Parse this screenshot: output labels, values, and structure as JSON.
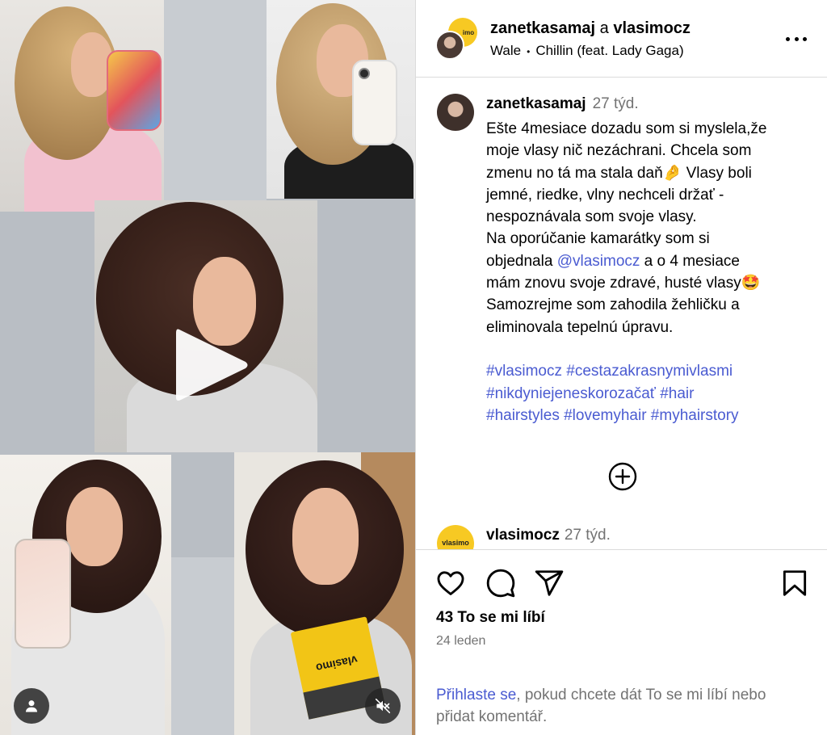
{
  "header": {
    "user1": "zanetkasamaj",
    "joiner": "a",
    "user2": "vlasimocz",
    "audio_artist": "Wale",
    "audio_track": "Chillin (feat. Lady Gaga)",
    "avatar_brand_text": "imo",
    "more_icon": "more-horizontal-icon"
  },
  "caption": {
    "username": "zanetkasamaj",
    "time_ago": "27 týd.",
    "lines": [
      "Ešte 4mesiace dozadu som si myslela,že",
      "moje vlasy nič nezáchrani. Chcela som",
      "zmenu no tá ma stala daň🤌 Vlasy boli",
      "jemné, riedke, vlny nechceli držať -",
      "nespoznávala som svoje vlasy.",
      "Na oporúčanie kamarátky som si"
    ],
    "mention_prefix": "objednala ",
    "mention": "@vlasimocz",
    "mention_suffix": " a o 4 mesiace",
    "lines_after": [
      "mám znovu svoje zdravé, husté vlasy🤩",
      "Samozrejme som zahodila žehličku a",
      "eliminovala tepelnú úpravu."
    ],
    "hashtags_line1": "#vlasimocz #cestazakrasnymivlasmi",
    "hashtags_line2": "#nikdyniejeneskorozačať #hair",
    "hashtags_line3": "#hairstyles #lovemyhair #myhairstory"
  },
  "comment": {
    "username": "vlasimocz",
    "time_ago": "27 týd.",
    "avatar_text": "vlasimo"
  },
  "actions": {
    "likes": "43 To se mi líbí",
    "date": "24 leden",
    "login_link": "Přihlaste se",
    "login_text": ", pokud chcete dát To se mi líbí nebo přidat komentář."
  },
  "media": {
    "product_label": "vlasimo",
    "play_icon": "play-icon",
    "user_icon": "user-tag-icon",
    "mute_icon": "volume-muted-icon"
  },
  "colors": {
    "accent_link": "#4a5bd1",
    "muted_text": "#737373",
    "divider": "#dbdbdb",
    "brand_yellow": "#f7c923"
  }
}
